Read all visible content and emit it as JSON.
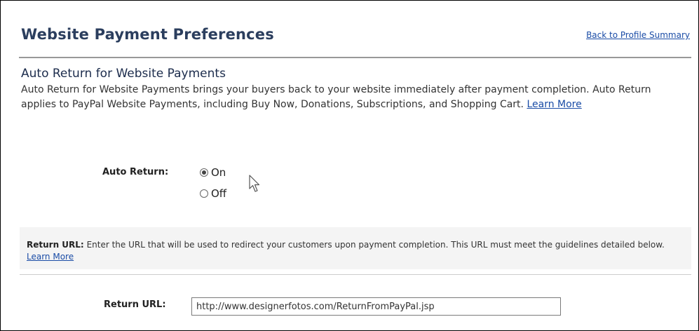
{
  "header": {
    "title": "Website Payment Preferences",
    "back_link": "Back to Profile Summary"
  },
  "auto_return_section": {
    "title": "Auto Return for Website Payments",
    "description": "Auto Return for Website Payments brings your buyers back to your website immediately after payment completion. Auto Return applies to PayPal Website Payments, including Buy Now, Donations, Subscriptions, and Shopping Cart.",
    "learn_more": "Learn More"
  },
  "auto_return": {
    "label": "Auto Return:",
    "options": [
      "On",
      "Off"
    ],
    "selected": "On"
  },
  "return_url_info": {
    "label": "Return URL:",
    "description": "Enter the URL that will be used to redirect your customers upon payment completion. This URL must meet the guidelines detailed below.",
    "learn_more": "Learn More"
  },
  "return_url_field": {
    "label": "Return URL:",
    "value": "http://www.designerfotos.com/ReturnFromPayPal.jsp"
  },
  "icons": {
    "cursor": "mouse-pointer-icon"
  }
}
